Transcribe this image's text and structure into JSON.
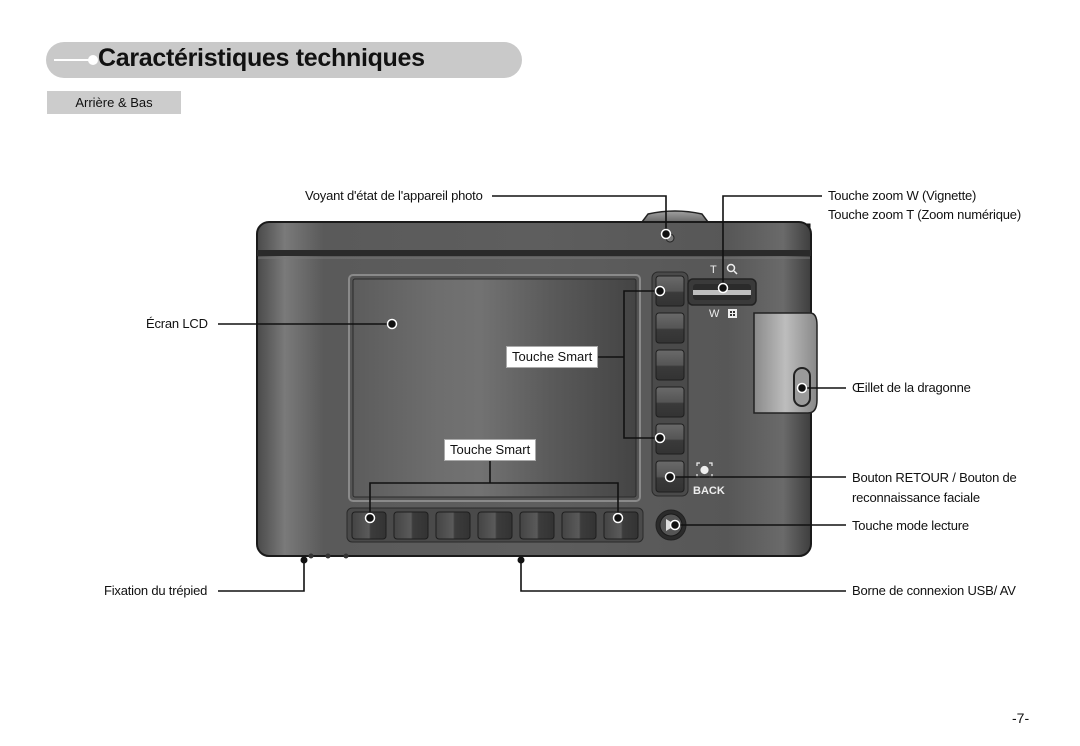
{
  "page": {
    "title": "Caractéristiques techniques",
    "section_tab": "Arrière & Bas",
    "page_number": "-7-"
  },
  "camera": {
    "zoom_key_labels": {
      "tele": "T",
      "wide": "W"
    },
    "back_label": "BACK"
  },
  "callouts": {
    "status_lamp": "Voyant d'état de l'appareil photo",
    "zoom_w": "Touche zoom W (Vignette)",
    "zoom_t": "Touche zoom T (Zoom numérique)",
    "lcd": "Écran LCD",
    "smart_side": "Touche Smart",
    "smart_bottom": "Touche Smart",
    "strap_eyelet": "Œillet de la dragonne",
    "back_button_line1": "Bouton RETOUR / Bouton de",
    "back_button_line2": "reconnaissance faciale",
    "playback": "Touche mode lecture",
    "tripod": "Fixation du trépied",
    "usb_av": "Borne de connexion USB/ AV"
  },
  "colors": {
    "title_bar": "#c9c9c9",
    "body_dark": "#555555",
    "body_mid": "#6a6a6a",
    "lcd": "#5e5e5e"
  }
}
